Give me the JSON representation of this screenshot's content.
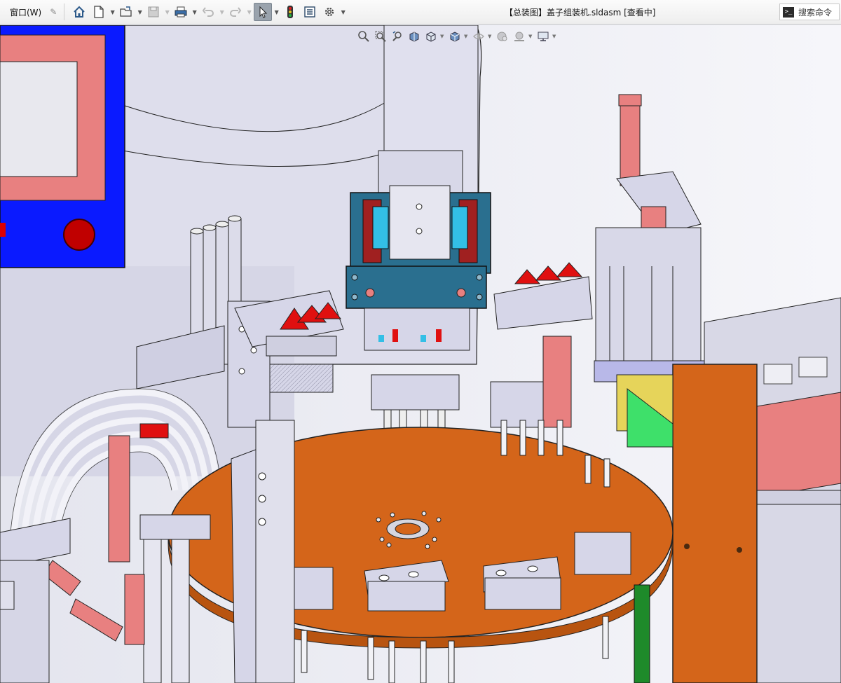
{
  "menu": {
    "window_label": "窗口(W)"
  },
  "toolbar": {
    "icons": [
      "home-icon",
      "new-document-icon",
      "open-folder-icon",
      "save-icon",
      "print-icon",
      "undo-icon",
      "redo-icon",
      "select-arrow-icon",
      "traffic-light-icon",
      "file-properties-icon",
      "gear-icon"
    ]
  },
  "document": {
    "title": "【总装图】盖子组装机.sldasm [查看中]"
  },
  "search": {
    "label": "搜索命令",
    "icon_text": ">_"
  },
  "view_toolbar": {
    "icons": [
      "zoom-to-fit-icon",
      "zoom-area-icon",
      "previous-view-icon",
      "section-view-icon",
      "view-orientation-icon",
      "display-style-icon",
      "hide-show-icon",
      "edit-appearance-icon",
      "apply-scene-icon",
      "view-settings-icon"
    ]
  },
  "colors": {
    "turntable_orange": "#d4651a",
    "part_lavender": "#d6d6e8",
    "part_edge": "#1a1a1a",
    "cylinder_red": "#e88080",
    "panel_blue": "#0a1aff",
    "teal_block": "#2a6f8f",
    "yellow_block": "#e6d45a",
    "green_block": "#3ee06a",
    "accent_red": "#e01010",
    "background": "#e8e9f0"
  }
}
